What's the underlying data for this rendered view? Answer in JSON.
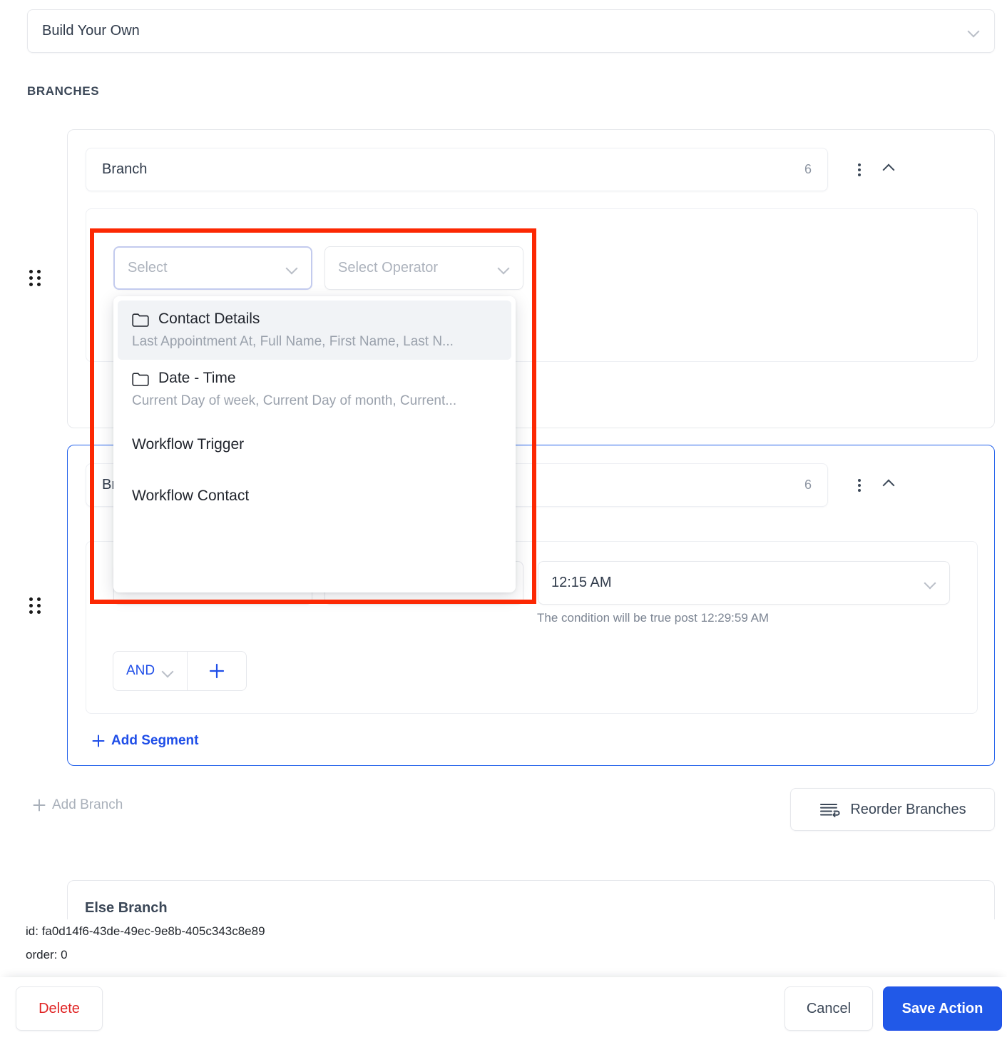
{
  "action_type": {
    "value": "Build Your Own",
    "chevron_icon": "chevron-down-icon"
  },
  "section": {
    "title": "BRANCHES"
  },
  "branches": [
    {
      "name": "Branch",
      "count": "6",
      "menu_icon": "kebab-menu-icon",
      "collapse_icon": "chevron-up-icon",
      "drag_icon": "drag-handle-icon",
      "field_placeholder": "Select",
      "operator_placeholder": "Select Operator",
      "add_segment_label": "Add Segment"
    },
    {
      "name": "Branch",
      "count": "6",
      "menu_icon": "kebab-menu-icon",
      "collapse_icon": "chevron-up-icon",
      "drag_icon": "drag-handle-icon",
      "time_value": "12:15 AM",
      "time_hint": "The condition will be true post 12:29:59 AM",
      "logic_operator": "AND",
      "add_condition_icon": "plus-icon",
      "add_segment_label": "Add Segment"
    }
  ],
  "dropdown": {
    "items": [
      {
        "label": "Contact Details",
        "description": "Last Appointment At, Full Name, First Name, Last N...",
        "icon": "folder-icon",
        "highlighted": true
      },
      {
        "label": "Date - Time",
        "description": "Current Day of week, Current Day of month, Current...",
        "icon": "folder-icon",
        "highlighted": false
      },
      {
        "label": "Workflow Trigger",
        "description": "",
        "icon": "",
        "highlighted": false
      },
      {
        "label": "Workflow Contact",
        "description": "",
        "icon": "",
        "highlighted": false
      }
    ]
  },
  "add_branch": {
    "label": "Add Branch",
    "icon": "plus-icon"
  },
  "reorder": {
    "label": "Reorder Branches",
    "icon": "reorder-icon"
  },
  "else_branch": {
    "label": "Else Branch"
  },
  "debug": {
    "id_line": "id: fa0d14f6-43de-49ec-9e8b-405c343c8e89",
    "order_line": "order: 0"
  },
  "footer": {
    "delete_label": "Delete",
    "cancel_label": "Cancel",
    "save_label": "Save Action"
  },
  "colors": {
    "accent_blue": "#2159e8",
    "link_blue": "#1f4ee8",
    "danger_red": "#e02424",
    "annotation_red": "#fc2803",
    "text_dark": "#2f3a4a",
    "text_muted": "#9aa1ac"
  }
}
